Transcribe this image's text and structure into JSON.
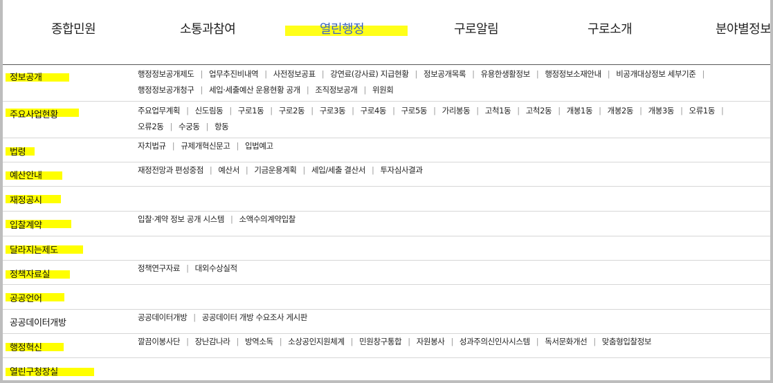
{
  "nav": {
    "items": [
      {
        "label": "종합민원",
        "active": false
      },
      {
        "label": "소통과참여",
        "active": false
      },
      {
        "label": "열린행정",
        "active": true
      },
      {
        "label": "구로알림",
        "active": false
      },
      {
        "label": "구로소개",
        "active": false
      },
      {
        "label": "분야별정보",
        "active": false
      }
    ],
    "active_color": "#3b63c4",
    "highlight_color": "#ffff00"
  },
  "rows": [
    {
      "category": "정보공개",
      "links": [
        [
          "행정정보공개제도",
          "업무추진비내역",
          "사전정보공표",
          "강연료(강사료) 지급현황",
          "정보공개목록",
          "유용한생활정보",
          "행정정보소재안내",
          "비공개대상정보 세부기준"
        ],
        [
          "행정정보공개청구",
          "세입·세출예산 운용현황 공개",
          "조직정보공개",
          "위원회"
        ]
      ]
    },
    {
      "category": "주요사업현황",
      "links": [
        [
          "주요업무계획",
          "신도림동",
          "구로1동",
          "구로2동",
          "구로3동",
          "구로4동",
          "구로5동",
          "가리봉동",
          "고척1동",
          "고척2동",
          "개봉1동",
          "개봉2동",
          "개봉3동",
          "오류1동"
        ],
        [
          "오류2동",
          "수궁동",
          "항동"
        ]
      ]
    },
    {
      "category": "법령",
      "links": [
        [
          "자치법규",
          "규제개혁신문고",
          "입법예고"
        ]
      ]
    },
    {
      "category": "예산안내",
      "links": [
        [
          "재정전망과 편성중점",
          "예산서",
          "기금운용계획",
          "세입/세출 결산서",
          "투자심사결과"
        ]
      ]
    },
    {
      "category": "재정공시",
      "links": []
    },
    {
      "category": "입찰계약",
      "links": [
        [
          "입찰·계약 정보 공개 시스템",
          "소액수의계약입찰"
        ]
      ]
    },
    {
      "category": "달라지는제도",
      "links": []
    },
    {
      "category": "정책자료실",
      "links": [
        [
          "정책연구자료",
          "대외수상실적"
        ]
      ]
    },
    {
      "category": "공공언어",
      "links": []
    },
    {
      "category": "공공데이터개방",
      "links": [
        [
          "공공데이터개방",
          "공공데이터 개방 수요조사 게시판"
        ]
      ]
    },
    {
      "category": "행정혁신",
      "links": [
        [
          "깔끔이봉사단",
          "장난감나라",
          "방역소독",
          "소상공인지원체계",
          "민원창구통합",
          "자원봉사",
          "성과주의신인사시스템",
          "독서문화개선",
          "맞춤형입찰정보"
        ]
      ]
    },
    {
      "category": "열린구청장실",
      "links": []
    }
  ]
}
